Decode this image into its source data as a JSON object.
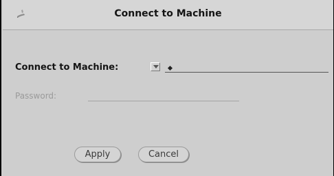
{
  "window": {
    "title": "Connect to Machine"
  },
  "form": {
    "connect_label": "Connect to Machine:",
    "connect_value": "",
    "password_label": "Password:",
    "password_value": ""
  },
  "buttons": {
    "apply_label": "Apply",
    "cancel_label": "Cancel"
  },
  "icons": {
    "window_menu": "window-menu-icon",
    "dropdown": "menu-arrow-icon"
  }
}
